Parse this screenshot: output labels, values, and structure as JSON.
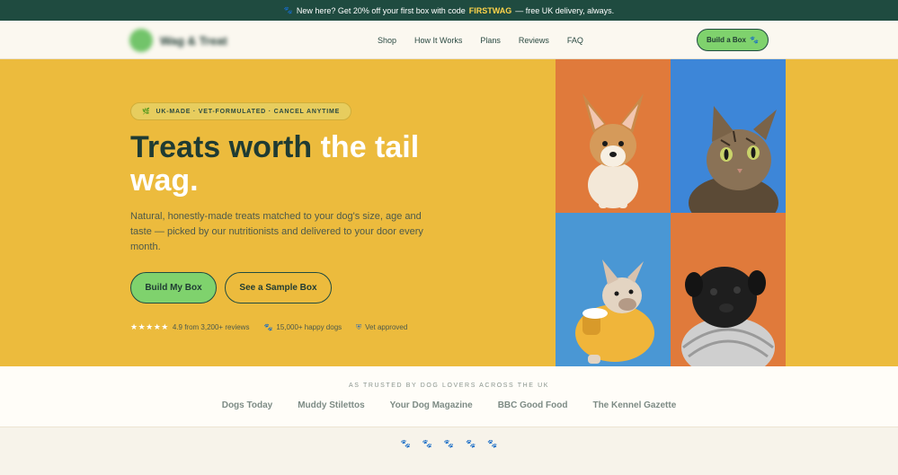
{
  "announcement": {
    "prefix": "New here? Get 20% off your first box with code",
    "code": "FIRSTWAG",
    "suffix": "— free UK delivery, always.",
    "icon": "paw-icon"
  },
  "header": {
    "logo_text": "Wag & Treat",
    "nav": [
      "Shop",
      "How It Works",
      "Plans",
      "Reviews",
      "FAQ"
    ],
    "cta_label": "Build a Box"
  },
  "hero": {
    "badge": "UK-MADE · VET-FORMULATED · CANCEL ANYTIME",
    "headline_part1": "Treats worth ",
    "headline_part2": "the tail wag.",
    "description": "Natural, honestly-made treats matched to your dog's size, age and taste — picked by our nutritionists and delivered to your door every month.",
    "primary_button": "Build My Box",
    "secondary_button": "See a Sample Box",
    "stars": "★★★★★",
    "rating": "4.9 from 3,200+ reviews",
    "dogs": "15,000+ happy dogs",
    "vet": "Vet approved"
  },
  "trusted": {
    "label": "AS TRUSTED BY DOG LOVERS ACROSS THE UK",
    "outlets": [
      "Dogs Today",
      "Muddy Stilettos",
      "Your Dog Magazine",
      "BBC Good Food",
      "The Kennel Gazette"
    ]
  },
  "colors": {
    "accent": "#7fd26d",
    "hero_bg": "#ecbb3d",
    "dark": "#1f4b40",
    "paw_colors": [
      "#5aa9d6",
      "#9fcf6d",
      "#e98a6a",
      "#c9b24f",
      "#5aa9d6"
    ]
  }
}
